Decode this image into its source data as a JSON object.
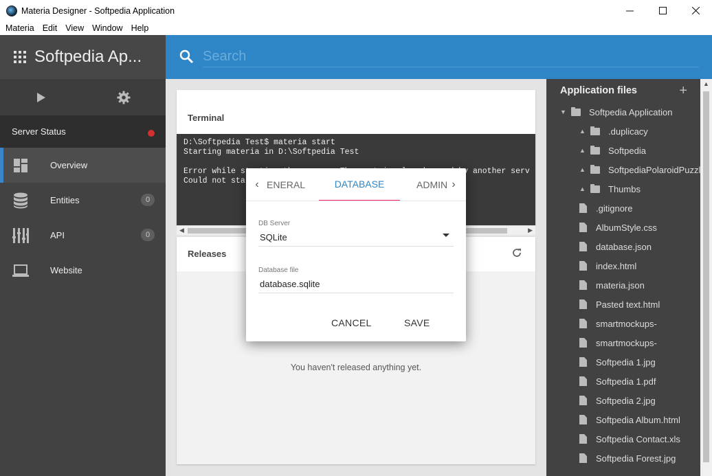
{
  "window": {
    "title": "Materia Designer - Softpedia Application"
  },
  "menu": [
    "Materia",
    "Edit",
    "View",
    "Window",
    "Help"
  ],
  "sidebar": {
    "title": "Softpedia Ap...",
    "server_status": "Server Status",
    "items": [
      {
        "label": "Overview",
        "icon": "dashboard-icon"
      },
      {
        "label": "Entities",
        "icon": "database-icon",
        "badge": "0"
      },
      {
        "label": "API",
        "icon": "equalizer-icon",
        "badge": "0"
      },
      {
        "label": "Website",
        "icon": "laptop-icon"
      }
    ]
  },
  "search": {
    "placeholder": "Search"
  },
  "terminal": {
    "title": "Terminal",
    "lines": "D:\\Softpedia Test$ materia start\nStarting materia in D:\\Softpedia Test\n\nError while starting the server: The port is already used by another serv\nCould not start materia: EADDRINUSE 127.0.0.1:8080"
  },
  "releases": {
    "title": "Releases",
    "empty_message": "You haven't released anything yet."
  },
  "files": {
    "title": "Application files",
    "root": "Softpedia Application",
    "folders": [
      ".duplicacy",
      "Softpedia",
      "SoftpediaPolaroidPuzzle",
      "Thumbs"
    ],
    "items": [
      ".gitignore",
      "AlbumStyle.css",
      "database.json",
      "index.html",
      "materia.json",
      "Pasted text.html",
      "smartmockups-",
      "smartmockups-",
      "Softpedia 1.jpg",
      "Softpedia 1.pdf",
      "Softpedia 2.jpg",
      "Softpedia Album.html",
      "Softpedia Contact.xls",
      "Softpedia Forest.jpg"
    ]
  },
  "dialog": {
    "tabs": [
      "ENERAL",
      "DATABASE",
      "ADMIN"
    ],
    "db_server_label": "DB Server",
    "db_server_value": "SQLite",
    "db_file_label": "Database file",
    "db_file_value": "database.sqlite",
    "cancel": "CANCEL",
    "save": "SAVE"
  },
  "colors": {
    "accent": "#2f86c6",
    "tab_indicator": "#e91e63",
    "status_error": "#d32f2f"
  }
}
